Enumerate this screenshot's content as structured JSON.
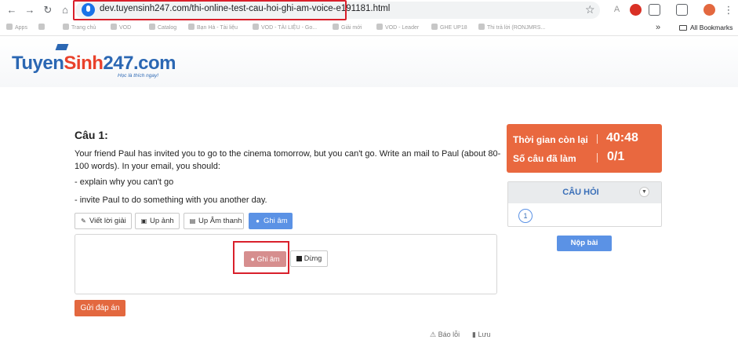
{
  "browser": {
    "url": "dev.tuyensinh247.com/thi-online-test-cau-hoi-ghi-am-voice-e191181.html",
    "all_bookmarks_label": "All Bookmarks",
    "more_label": "»",
    "bookmarks": [
      "Apps",
      "Trang chủ",
      "VOD",
      "Catalog",
      "Bạn Hà - Tài liệu",
      "VOD - TÀI LIỆU - Go...",
      "Giải mới",
      "VOD - Leader",
      "GHE UP18",
      "Thi trả lời (RONJMRS..."
    ]
  },
  "site": {
    "logo_part1": "Tuyen",
    "logo_part2": "Sinh",
    "logo_part3": "247.com",
    "tagline": "Học là thích ngay!"
  },
  "question": {
    "title": "Câu 1:",
    "text": "Your friend Paul has invited you to go to the cinema tomorrow, but you can't go. Write an mail to Paul (about 80-100 words). In your email, you should:",
    "bullet1": "- explain why you can't go",
    "bullet2": "- invite Paul to do something with you another day."
  },
  "tools": {
    "write": "Viết lời giải",
    "upload_image": "Up ảnh",
    "upload_audio": "Up Âm thanh",
    "record": "Ghi âm"
  },
  "recorder": {
    "record_label": "Ghi âm",
    "stop_label": "Dừng"
  },
  "actions": {
    "submit_answer": "Gửi đáp án",
    "report": "Báo lỗi",
    "save": "Lưu",
    "submit_test": "Nộp bài"
  },
  "sidebar": {
    "time_left_label": "Thời gian còn lại",
    "time_left_value": "40:48",
    "answered_label": "Số câu đã làm",
    "answered_value": "0/1",
    "questions_title": "CÂU HỎI",
    "question_numbers": [
      "1"
    ]
  },
  "colors": {
    "accent_orange": "#e9683f",
    "accent_blue": "#5b92e5",
    "highlight_red": "#d9202b"
  }
}
